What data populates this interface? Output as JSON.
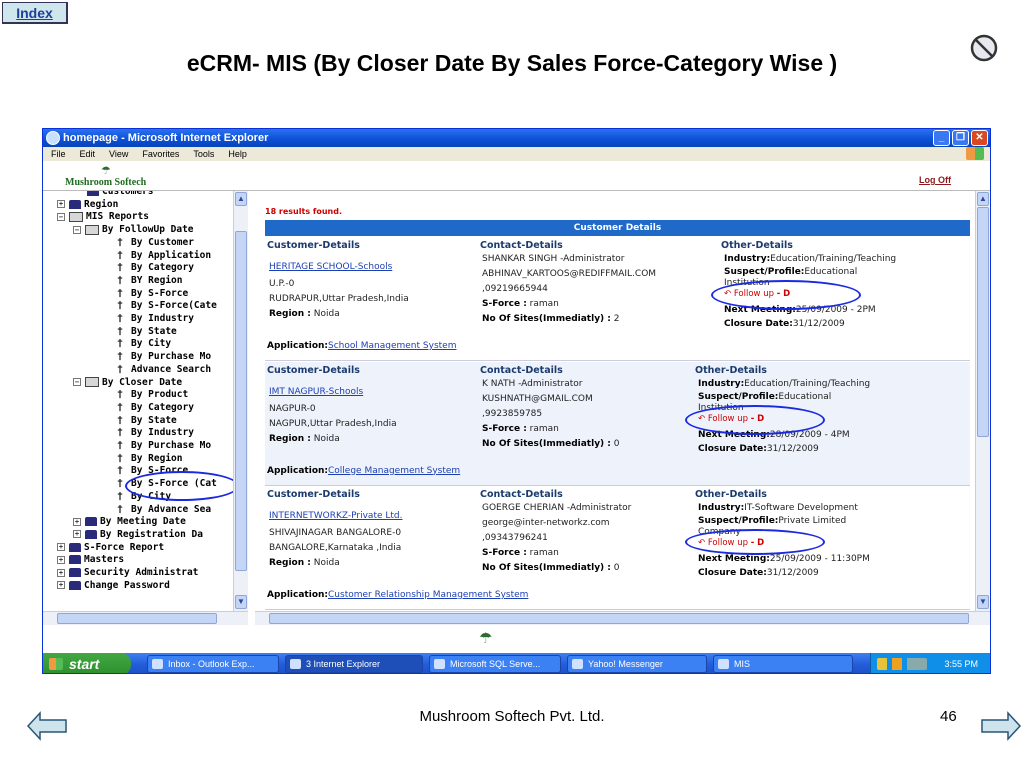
{
  "slide": {
    "index_label": "Index",
    "title": "eCRM- MIS (By Closer Date By Sales Force-Category Wise )",
    "footer": "Mushroom Softech Pvt. Ltd.",
    "page_number": "46"
  },
  "window": {
    "title": "homepage - Microsoft Internet Explorer",
    "menu": [
      "File",
      "Edit",
      "View",
      "Favorites",
      "Tools",
      "Help"
    ]
  },
  "app": {
    "brand": "Mushroom Softech",
    "logoff": "Log Off"
  },
  "tree": [
    {
      "label": "Customers",
      "level": 2,
      "kind": "cut"
    },
    {
      "label": "Region",
      "level": 1,
      "kind": "folder",
      "plus": "+"
    },
    {
      "label": "MIS Reports",
      "level": 1,
      "kind": "book",
      "plus": "-"
    },
    {
      "label": "By FollowUp Date",
      "level": 2,
      "kind": "book",
      "plus": "-"
    },
    {
      "label": "By Customer",
      "level": 3,
      "kind": "pin"
    },
    {
      "label": "By Application",
      "level": 3,
      "kind": "pin"
    },
    {
      "label": "By Category",
      "level": 3,
      "kind": "pin"
    },
    {
      "label": "BY Region",
      "level": 3,
      "kind": "pin"
    },
    {
      "label": "By S-Force",
      "level": 3,
      "kind": "pin"
    },
    {
      "label": "By S-Force(Cate",
      "level": 3,
      "kind": "pin"
    },
    {
      "label": "By Industry",
      "level": 3,
      "kind": "pin"
    },
    {
      "label": "By State",
      "level": 3,
      "kind": "pin"
    },
    {
      "label": "By City",
      "level": 3,
      "kind": "pin"
    },
    {
      "label": "By Purchase Mo",
      "level": 3,
      "kind": "pin"
    },
    {
      "label": "Advance Search",
      "level": 3,
      "kind": "pin"
    },
    {
      "label": "By Closer Date",
      "level": 2,
      "kind": "book",
      "plus": "-"
    },
    {
      "label": "By Product",
      "level": 3,
      "kind": "pin"
    },
    {
      "label": "By Category",
      "level": 3,
      "kind": "pin"
    },
    {
      "label": "By State",
      "level": 3,
      "kind": "pin"
    },
    {
      "label": "By Industry",
      "level": 3,
      "kind": "pin"
    },
    {
      "label": "By Purchase Mo",
      "level": 3,
      "kind": "pin"
    },
    {
      "label": "By Region",
      "level": 3,
      "kind": "pin"
    },
    {
      "label": "By S-Force",
      "level": 3,
      "kind": "pin"
    },
    {
      "label": "By S-Force (Cat",
      "level": 3,
      "kind": "pin"
    },
    {
      "label": "By City",
      "level": 3,
      "kind": "pin"
    },
    {
      "label": "By Advance Sea",
      "level": 3,
      "kind": "pin"
    },
    {
      "label": "By Meeting Date",
      "level": 2,
      "kind": "folder",
      "plus": "+"
    },
    {
      "label": "By Registration Da",
      "level": 2,
      "kind": "folder",
      "plus": "+"
    },
    {
      "label": "S-Force Report",
      "level": 1,
      "kind": "folder",
      "plus": "+"
    },
    {
      "label": "Masters",
      "level": 1,
      "kind": "folder",
      "plus": "+"
    },
    {
      "label": "Security Administrat",
      "level": 1,
      "kind": "folder",
      "plus": "+"
    },
    {
      "label": "Change Password",
      "level": 1,
      "kind": "folder",
      "plus": "+"
    }
  ],
  "results": {
    "count_text": "18 results found.",
    "section_title": "Customer Details",
    "headers": {
      "customer": "Customer-Details",
      "contact": "Contact-Details",
      "other": "Other-Details"
    },
    "labels": {
      "region": "Region :",
      "sforce": "S-Force :",
      "sites": "No Of Sites(Immediatly) :",
      "industry": "Industry:",
      "suspect": "Suspect/Profile:",
      "next_meeting": "Next Meeting:",
      "closure": "Closure Date:",
      "application": "Application:",
      "followup": "Follow up",
      "followup_suffix": "- D"
    },
    "records": [
      {
        "name": "HERITAGE SCHOOL-Schools",
        "addr1": "U.P.-0",
        "addr2": "RUDRAPUR,Uttar Pradesh,India",
        "region": "Noida",
        "contact_name": "SHANKAR SINGH -Administrator",
        "email": "ABHINAV_KARTOOS@REDIFFMAIL.COM",
        "phone": ",09219665944",
        "sforce": "raman",
        "sites": "2",
        "industry": "Education/Training/Teaching",
        "suspect": "Educational",
        "suspect2": "Institution",
        "next_meeting": "25/09/2009 - 2PM",
        "closure": "31/12/2009",
        "application": "School Management System"
      },
      {
        "name": "IMT NAGPUR-Schools",
        "addr1": "NAGPUR-0",
        "addr2": "NAGPUR,Uttar Pradesh,India",
        "region": "Noida",
        "contact_name": "K NATH -Administrator",
        "email": "KUSHNATH@GMAIL.COM",
        "phone": ",9923859785",
        "sforce": "raman",
        "sites": "0",
        "industry": "Education/Training/Teaching",
        "suspect": "Educational",
        "suspect2": "Institution",
        "next_meeting": "28/09/2009 - 4PM",
        "closure": "31/12/2009",
        "application": "College Management System"
      },
      {
        "name": "INTERNETWORKZ-Private Ltd.",
        "addr1": "SHIVAJINAGAR BANGALORE-0",
        "addr2": "BANGALORE,Karnataka ,India",
        "region": "Noida",
        "contact_name": "GOERGE CHERIAN -Administrator",
        "email": "george@inter-networkz.com",
        "phone": ",09343796241",
        "sforce": "raman",
        "sites": "0",
        "industry": "IT-Software Development",
        "suspect": "Private Limited",
        "suspect2": "Company",
        "next_meeting": "25/09/2009 - 11:30PM",
        "closure": "31/12/2009",
        "application": "Customer Relationship Management System"
      }
    ]
  },
  "taskbar": {
    "start": "start",
    "tasks": [
      "Inbox - Outlook Exp...",
      "3 Internet Explorer",
      "Microsoft SQL Serve...",
      "Yahoo! Messenger",
      "MIS"
    ],
    "clock": "3:55 PM"
  },
  "colors": {
    "accent": "#1f69c9",
    "annotation": "#1a2ae0",
    "alert": "#cc0000"
  }
}
